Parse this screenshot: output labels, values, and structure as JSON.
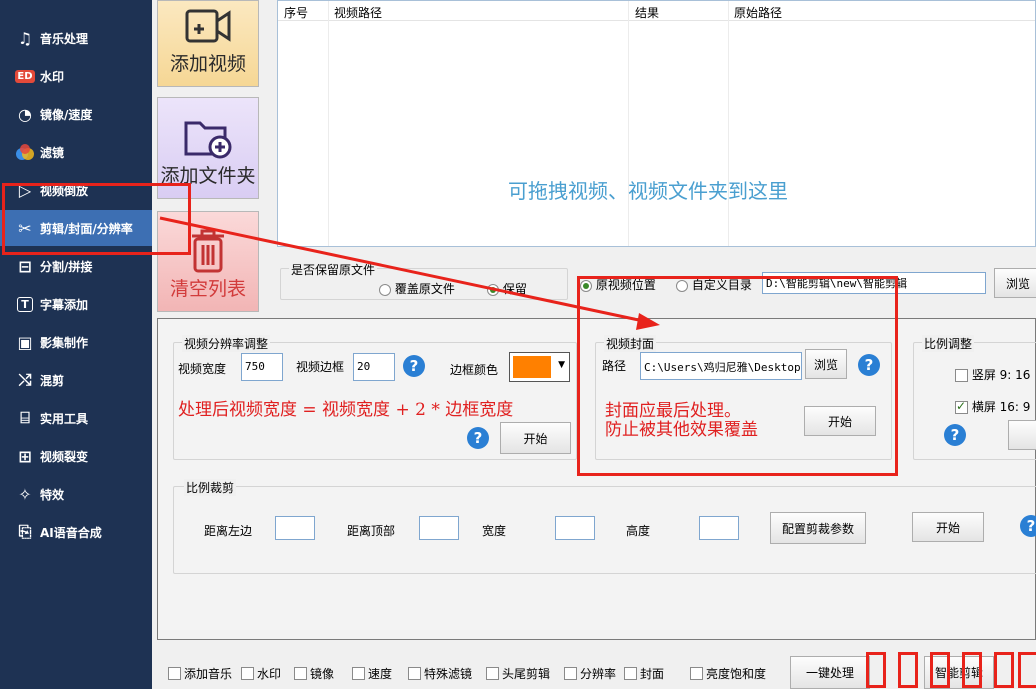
{
  "sidebar": {
    "items": [
      {
        "label": "音乐处理",
        "icon": "music-icon"
      },
      {
        "label": "水印",
        "icon": "watermark-icon"
      },
      {
        "label": "镜像/速度",
        "icon": "speedometer-icon"
      },
      {
        "label": "滤镜",
        "icon": "filter-icon"
      },
      {
        "label": "视频倒放",
        "icon": "reverse-play-icon"
      },
      {
        "label": "剪辑/封面/分辨率",
        "icon": "scissors-icon",
        "active": true
      },
      {
        "label": "分割/拼接",
        "icon": "split-icon"
      },
      {
        "label": "字幕添加",
        "icon": "text-icon"
      },
      {
        "label": "影集制作",
        "icon": "album-icon"
      },
      {
        "label": "混剪",
        "icon": "shuffle-icon"
      },
      {
        "label": "实用工具",
        "icon": "toolbox-icon"
      },
      {
        "label": "视频裂变",
        "icon": "video-split-icon"
      },
      {
        "label": "特效",
        "icon": "effects-icon"
      },
      {
        "label": "AI语音合成",
        "icon": "ai-voice-icon"
      }
    ]
  },
  "actions": {
    "add_video": "添加视频",
    "add_folder": "添加文件夹",
    "clear_list": "清空列表"
  },
  "filelist": {
    "columns": [
      "序号",
      "视频路径",
      "结果",
      "原始路径"
    ],
    "drop_hint": "可拖拽视频、视频文件夹到这里"
  },
  "keep_original": {
    "title": "是否保留原文件",
    "options": [
      "覆盖原文件",
      "保留"
    ],
    "selected": "保留"
  },
  "output": {
    "options": [
      "原视频位置",
      "自定义目录"
    ],
    "selected": "原视频位置",
    "path": "D:\\智能剪辑\\new\\智能剪辑",
    "browse": "浏览"
  },
  "resolution": {
    "title": "视频分辨率调整",
    "width_label": "视频宽度",
    "width_value": "750",
    "border_label": "视频边框",
    "border_value": "20",
    "border_color_label": "边框颜色",
    "border_color": "#ff8000",
    "note": "处理后视频宽度 = 视频宽度 + 2 * 边框宽度",
    "start": "开始"
  },
  "cover": {
    "title": "视频封面",
    "path_label": "路径",
    "path_value": "C:\\Users\\鸡归尼雅\\Desktop\\",
    "browse": "浏览",
    "note_line1": "封面应最后处理。",
    "note_line2": "防止被其他效果覆盖",
    "start": "开始"
  },
  "ratio": {
    "title": "比例调整",
    "portrait": "竖屏 9: 16",
    "landscape": "横屏 16: 9",
    "landscape_checked": true
  },
  "crop": {
    "title": "比例裁剪",
    "left_label": "距离左边",
    "top_label": "距离顶部",
    "width_label": "宽度",
    "height_label": "高度",
    "config": "配置剪裁参数",
    "start": "开始"
  },
  "bottom": {
    "options": [
      "添加音乐",
      "水印",
      "镜像",
      "速度",
      "特殊滤镜",
      "头尾剪辑",
      "分辨率",
      "封面",
      "亮度饱和度"
    ],
    "one_click": "一键处理",
    "smart_clip": "智能剪辑"
  },
  "colors": {
    "annotation_red": "#e8231b",
    "sidebar_bg": "#1e3253",
    "sidebar_active": "#3d6fb3"
  }
}
